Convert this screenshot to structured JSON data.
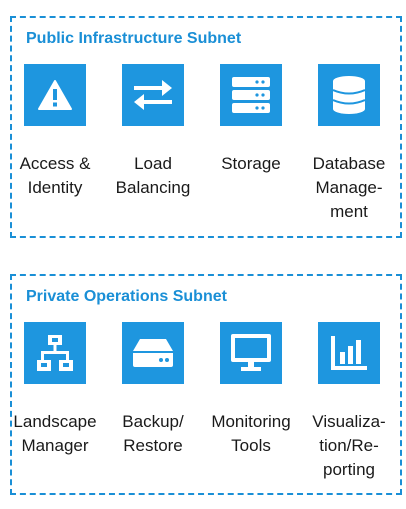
{
  "colors": {
    "accent": "#1a8fd6",
    "tile": "#1e96df",
    "text": "#1a1a1a"
  },
  "subnets": [
    {
      "title": "Public Infrastructure Subnet",
      "items": [
        {
          "icon": "warning-icon",
          "label_lines": [
            "Access &",
            "Identity"
          ]
        },
        {
          "icon": "transfer-arrows-icon",
          "label_lines": [
            "Load",
            "Balancing"
          ]
        },
        {
          "icon": "server-stack-icon",
          "label_lines": [
            "Storage"
          ]
        },
        {
          "icon": "database-icon",
          "label_lines": [
            "Database",
            "Manage-",
            "ment"
          ]
        }
      ]
    },
    {
      "title": "Private Operations Subnet",
      "items": [
        {
          "icon": "network-hierarchy-icon",
          "label_lines": [
            "Landscape",
            "Manager"
          ]
        },
        {
          "icon": "hard-drive-icon",
          "label_lines": [
            "Backup/",
            "Restore"
          ]
        },
        {
          "icon": "monitor-icon",
          "label_lines": [
            "Monitoring",
            "Tools"
          ]
        },
        {
          "icon": "bar-chart-icon",
          "label_lines": [
            "Visualiza-",
            "tion/Re-",
            "porting"
          ]
        }
      ]
    }
  ]
}
